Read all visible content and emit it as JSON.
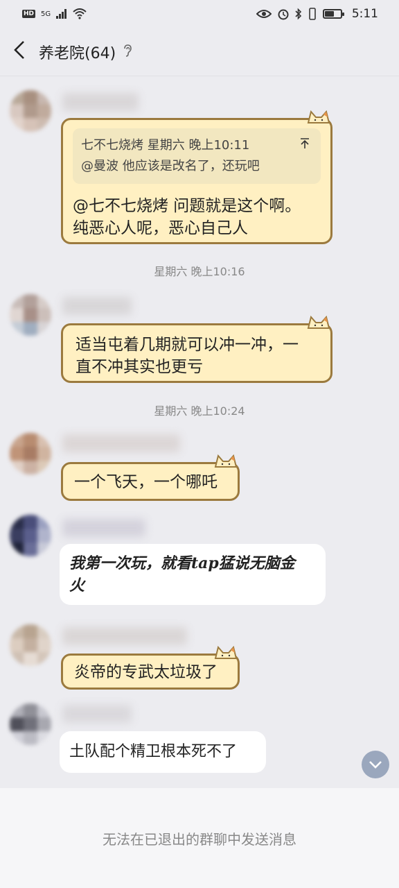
{
  "status": {
    "network": "HD",
    "signal": "5G",
    "time": "5:11"
  },
  "header": {
    "title": "养老院(64)"
  },
  "messages": [
    {
      "quote_head": "七不七烧烤 星期六 晚上10:11",
      "quote_body": "@曼波 他应该是改名了，还玩吧",
      "line1": "@七不七烧烤 问题就是这个啊。",
      "line2": "纯恶心人呢，恶心自己人"
    },
    {
      "timestamp": "星期六 晚上10:16"
    },
    {
      "line1": "适当屯着几期就可以冲一冲，一",
      "line2": "直不冲其实也更亏"
    },
    {
      "timestamp": "星期六 晚上10:24"
    },
    {
      "text": "一个飞天，一个哪吒"
    },
    {
      "line1": "我第一次玩，就看tap猛说无脑金",
      "line2": "火"
    },
    {
      "text": "炎帝的专武太垃圾了"
    },
    {
      "text": "土队配个精卫根本死不了"
    }
  ],
  "footer": {
    "notice": "无法在已退出的群聊中发送消息"
  },
  "colors": {
    "bubble_fill": "#fff0c2",
    "bubble_border": "#9b7a3e",
    "background": "#ececf0"
  },
  "battery_level": 0.6
}
